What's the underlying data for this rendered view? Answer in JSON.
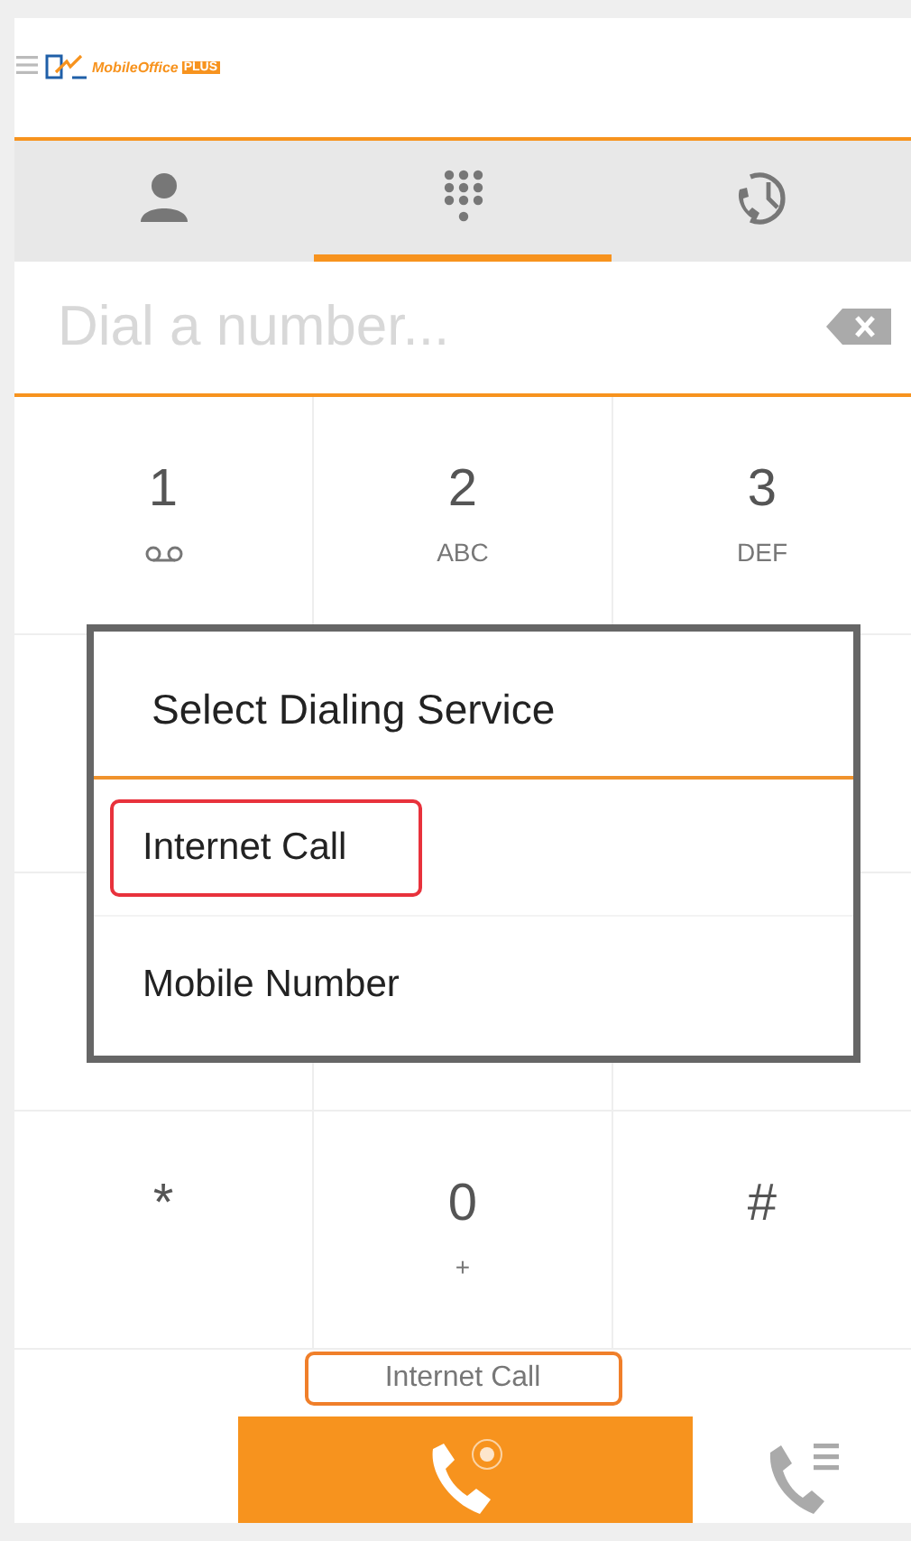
{
  "header": {
    "logo": {
      "name": "MobileOffice",
      "badge": "PLUS"
    }
  },
  "tabs": [
    {
      "kind": "contacts",
      "selected": false
    },
    {
      "kind": "dialpad",
      "selected": true
    },
    {
      "kind": "history",
      "selected": false
    }
  ],
  "dial_field": {
    "placeholder": "Dial a number..."
  },
  "keypad": [
    [
      {
        "kind": "voicemail",
        "digit": "1"
      },
      {
        "kind": "letters",
        "digit": "2",
        "letters": "ABC"
      },
      {
        "kind": "letters",
        "digit": "3",
        "letters": "DEF"
      }
    ],
    [
      {
        "kind": "covered"
      },
      {
        "kind": "covered"
      },
      {
        "kind": "covered"
      }
    ],
    [
      {
        "kind": "covered"
      },
      {
        "kind": "covered"
      },
      {
        "kind": "covered"
      }
    ],
    [
      {
        "kind": "symbol",
        "digit": "*"
      },
      {
        "kind": "letters",
        "digit": "0",
        "letters": "+"
      },
      {
        "kind": "symbol",
        "digit": "#"
      }
    ]
  ],
  "dialog": {
    "title": "Select Dialing Service",
    "options": [
      {
        "label": "Internet Call",
        "selected": true
      },
      {
        "label": "Mobile Number",
        "selected": false
      }
    ]
  },
  "service_label": "Internet Call"
}
